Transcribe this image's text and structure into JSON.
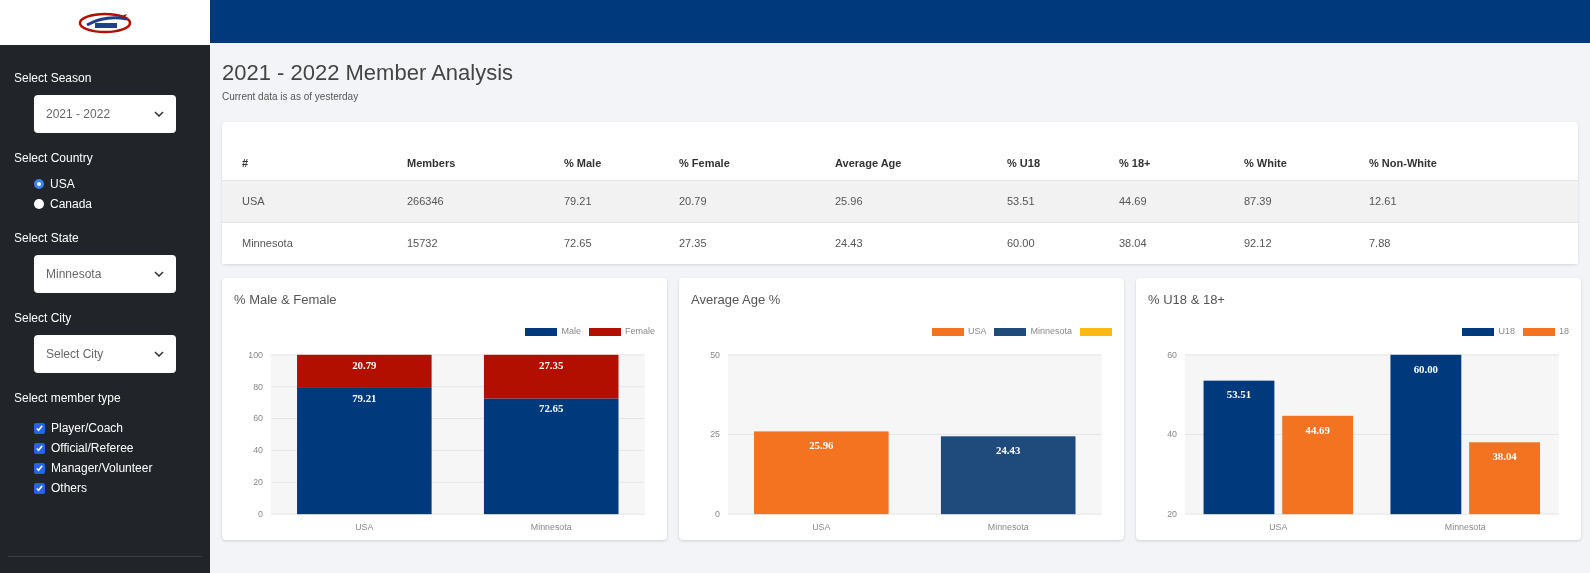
{
  "sidebar": {
    "sections": [
      {
        "label": "Select Season",
        "kind": "select",
        "value": "2021 - 2022"
      },
      {
        "label": "Select Country",
        "kind": "radio",
        "options": [
          {
            "label": "USA",
            "selected": true
          },
          {
            "label": "Canada",
            "selected": false
          }
        ]
      },
      {
        "label": "Select State",
        "kind": "select",
        "value": "Minnesota"
      },
      {
        "label": "Select City",
        "kind": "select",
        "placeholder": "Select City"
      },
      {
        "label": "Select member type",
        "kind": "checkbox",
        "options": [
          {
            "label": "Player/Coach",
            "checked": true
          },
          {
            "label": "Official/Referee",
            "checked": true
          },
          {
            "label": "Manager/Volunteer",
            "checked": true
          },
          {
            "label": "Others",
            "checked": true
          }
        ]
      }
    ]
  },
  "page": {
    "title": "2021 - 2022 Member Analysis",
    "subtitle": "Current data is as of yesterday"
  },
  "table": {
    "columns": [
      "#",
      "Members",
      "% Male",
      "% Female",
      "Average Age",
      "% U18",
      "% 18+",
      "% White",
      "% Non-White"
    ],
    "rows": [
      [
        "USA",
        "266346",
        "79.21",
        "20.79",
        "25.96",
        "53.51",
        "44.69",
        "87.39",
        "12.61"
      ],
      [
        "Minnesota",
        "15732",
        "72.65",
        "27.35",
        "24.43",
        "60.00",
        "38.04",
        "92.12",
        "7.88"
      ]
    ]
  },
  "charts": [
    {
      "title": "% Male & Female",
      "chart_data": {
        "type": "bar",
        "stacked": true,
        "grid": true,
        "legend": true,
        "value_labels": [
          [
            "79.21",
            "72.65"
          ],
          [
            "20.79",
            "27.35"
          ]
        ],
        "categories": [
          "USA",
          "Minnesota"
        ],
        "series": [
          {
            "name": "Male",
            "color": "#003a7d",
            "values": [
              79.21,
              72.65
            ]
          },
          {
            "name": "Female",
            "color": "#b30f00",
            "values": [
              20.79,
              27.35
            ]
          }
        ],
        "ylim": [
          0,
          100
        ],
        "yticks": [
          0,
          20,
          40,
          60,
          80,
          100
        ]
      }
    },
    {
      "title": "Average Age %",
      "chart_data": {
        "type": "bar",
        "stacked": false,
        "grid": true,
        "legend": true,
        "value_labels": [
          [
            "25.96",
            null
          ],
          [
            null,
            "24.43"
          ],
          [
            null,
            null
          ]
        ],
        "categories": [
          "USA",
          "Minnesota"
        ],
        "series": [
          {
            "name": "USA",
            "color": "#f47321",
            "values": [
              25.96,
              null
            ]
          },
          {
            "name": "Minnesota",
            "color": "#1f4a7c",
            "values": [
              null,
              24.43
            ]
          },
          {
            "color": "#fdb913",
            "values": [
              null,
              null
            ]
          }
        ],
        "ylim": [
          0,
          50
        ],
        "yticks": [
          0,
          25,
          50
        ]
      }
    },
    {
      "title": "% U18 & 18+",
      "chart_data": {
        "type": "bar",
        "stacked": false,
        "grid": true,
        "legend": true,
        "value_labels": [
          [
            "53.51",
            "60.00"
          ],
          [
            "44.69",
            "38.04"
          ]
        ],
        "categories": [
          "USA",
          "Minnesota"
        ],
        "series": [
          {
            "name": "U18",
            "color": "#003a7d",
            "values": [
              53.51,
              60.0
            ]
          },
          {
            "name": "18",
            "color": "#f47321",
            "values": [
              44.69,
              38.04
            ]
          }
        ],
        "ylim": [
          20,
          60
        ],
        "yticks": [
          20,
          40,
          60
        ]
      }
    }
  ]
}
